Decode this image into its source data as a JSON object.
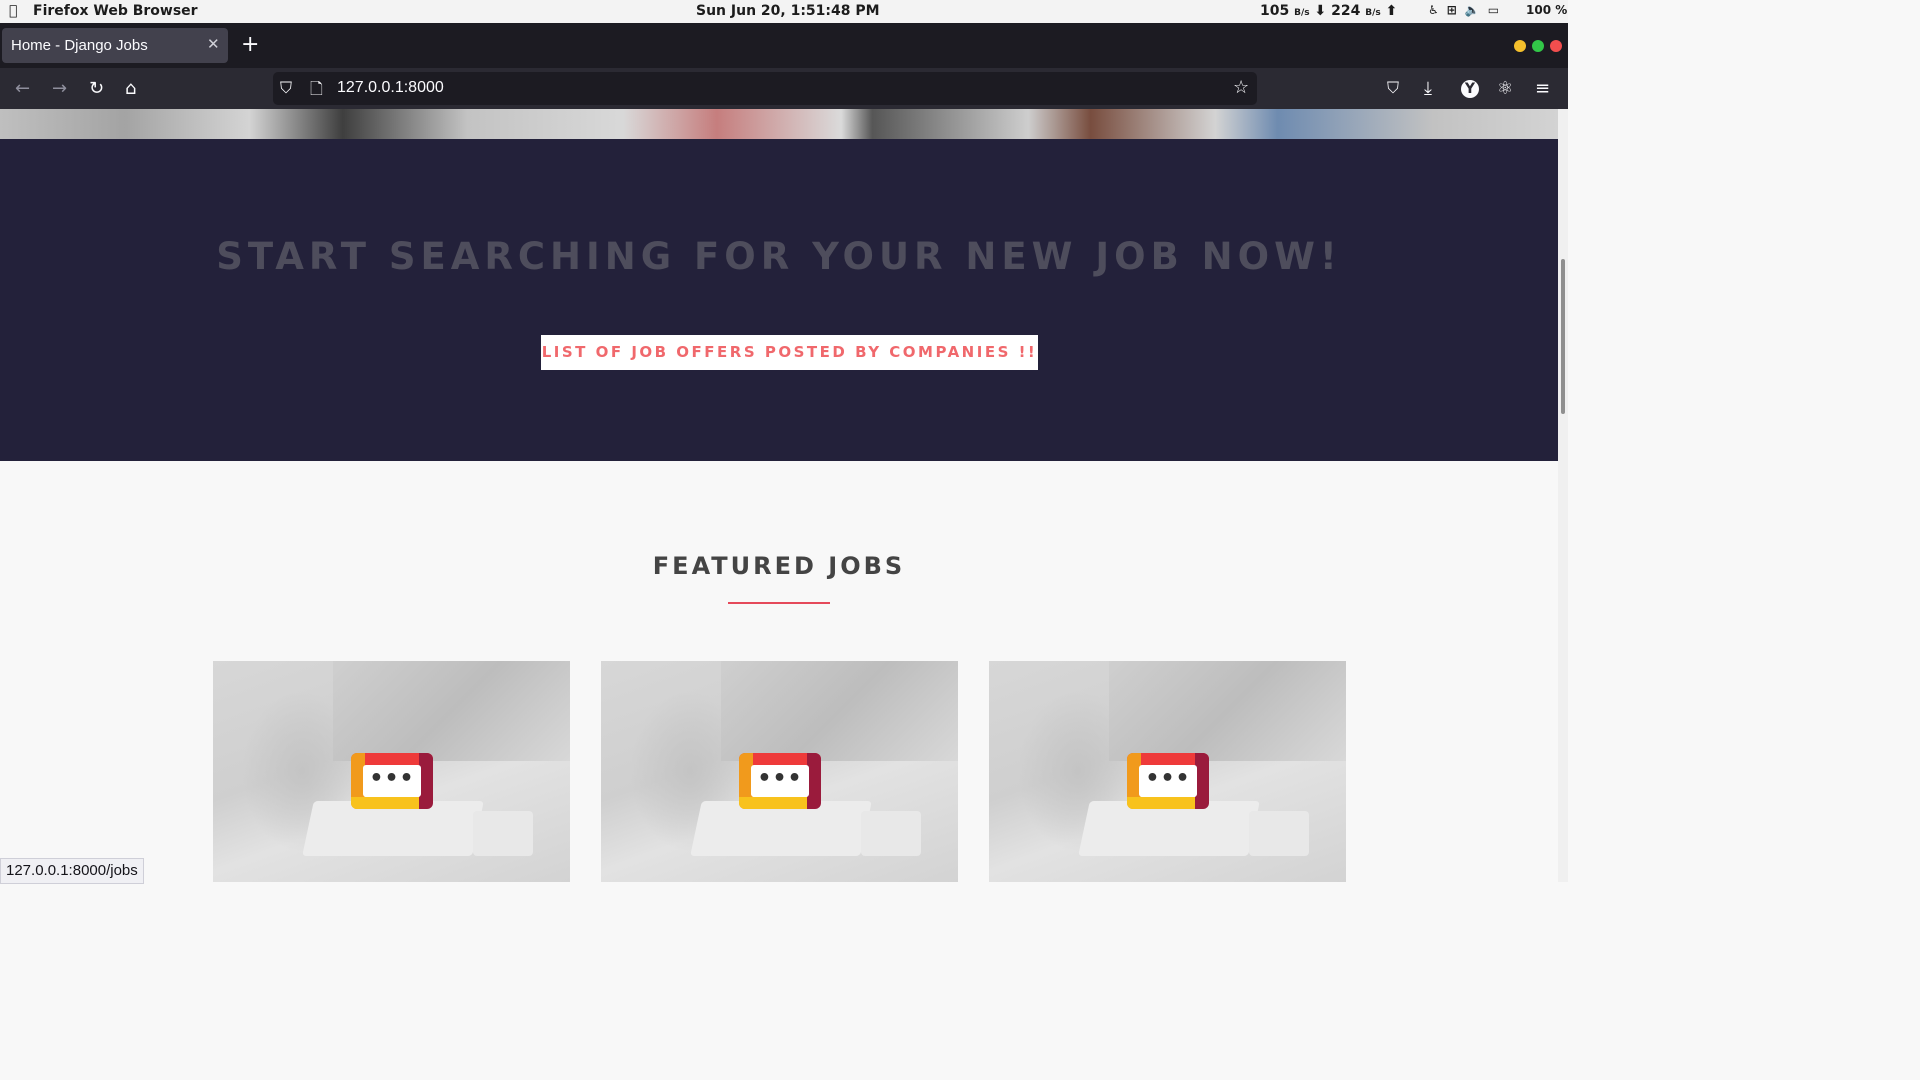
{
  "os_bar": {
    "app_name": "Firefox Web Browser",
    "clock": "Sun Jun 20,  1:51:48 PM",
    "net_up": "105",
    "net_unit": "B/s",
    "net_down": "224",
    "battery": "100 %"
  },
  "browser": {
    "tab_title": "Home - Django Jobs",
    "url": "127.0.0.1:8000",
    "status_url": "127.0.0.1:8000/jobs"
  },
  "page": {
    "banner_heading": "START SEARCHING FOR YOUR NEW JOB NOW!",
    "banner_button": "LIST OF JOB OFFERS POSTED BY COMPANIES !!",
    "featured_heading": "FEATURED JOBS",
    "job_cards": [
      {
        "logo_text": "•••"
      },
      {
        "logo_text": "•••"
      },
      {
        "logo_text": "•••"
      }
    ]
  },
  "colors": {
    "banner_bg": "#23213a",
    "accent": "#f0686c",
    "underline": "#e5495a"
  }
}
